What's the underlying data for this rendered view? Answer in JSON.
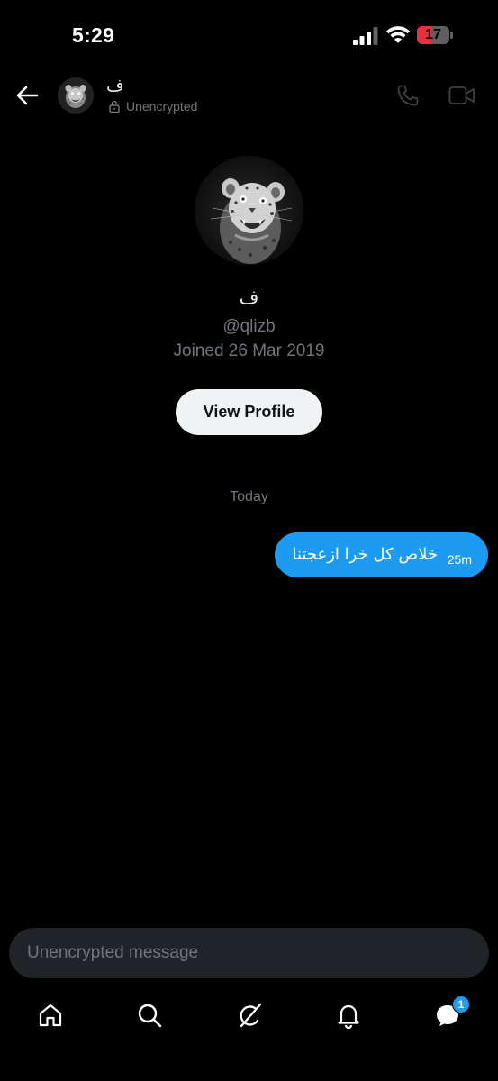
{
  "status_bar": {
    "time": "5:29",
    "battery_level": "17",
    "battery_fraction": 0.17,
    "battery_color": "#e8313e"
  },
  "header": {
    "back_icon": "arrow-left-icon",
    "contact_name": "ف",
    "encryption_status": "Unencrypted",
    "lock_icon": "unlocked-padlock-icon",
    "call_icon": "phone-icon",
    "video_icon": "video-camera-icon"
  },
  "profile": {
    "avatar_subject": "snarling leopard, black and white",
    "name": "ف",
    "handle": "@qlizb",
    "joined": "Joined 26 Mar 2019",
    "view_profile_label": "View Profile"
  },
  "conversation": {
    "date_separator": "Today",
    "messages": [
      {
        "direction": "outgoing",
        "text": "خلاص كل خرا ازعجتنا",
        "time": "25m",
        "bubble_color": "#1d9bf0"
      }
    ]
  },
  "composer": {
    "placeholder": "Unencrypted message",
    "value": ""
  },
  "tab_bar": {
    "tabs": [
      {
        "name": "home",
        "icon": "home-icon"
      },
      {
        "name": "search",
        "icon": "search-icon"
      },
      {
        "name": "grok",
        "icon": "grok-slash-icon"
      },
      {
        "name": "notifications",
        "icon": "bell-icon"
      },
      {
        "name": "messages",
        "icon": "chat-bubble-icon",
        "badge": "1"
      }
    ]
  },
  "colors": {
    "background": "#000000",
    "accent": "#1d9bf0",
    "secondary_text": "#71767b",
    "primary_text": "#e7e9ea"
  }
}
